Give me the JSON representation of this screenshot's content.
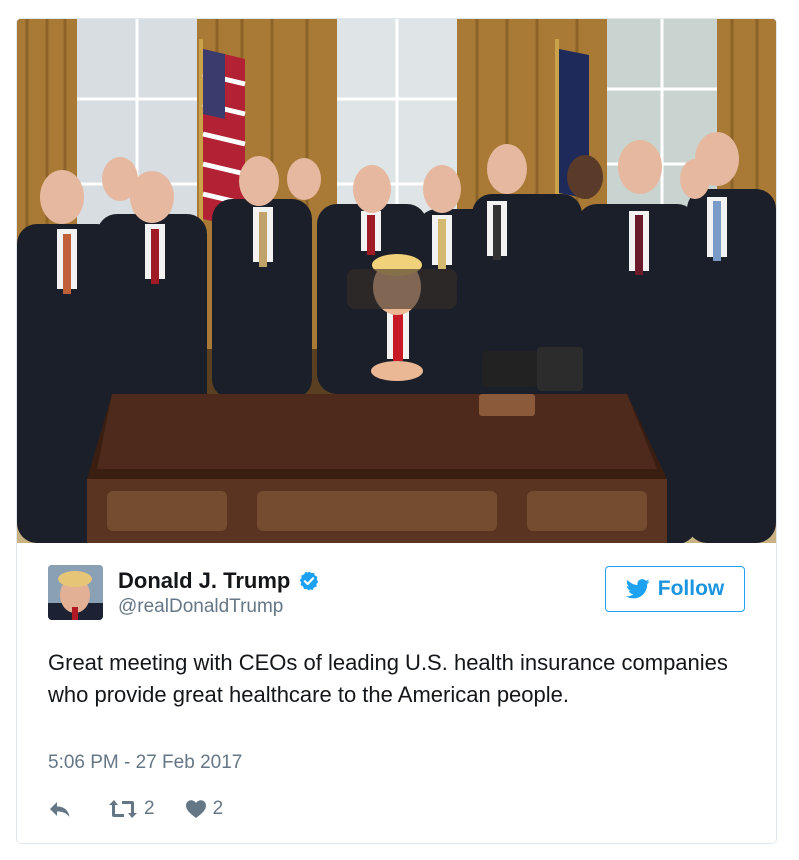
{
  "tweet": {
    "author": {
      "display_name": "Donald J. Trump",
      "handle": "@realDonaldTrump",
      "verified": true
    },
    "follow_label": "Follow",
    "text": "Great meeting with CEOs of leading U.S. health insurance companies who provide great healthcare to the American people.",
    "timestamp": "5:06 PM - 27 Feb 2017",
    "actions": {
      "reply_icon": "reply-icon",
      "retweet_icon": "retweet-icon",
      "retweet_count": "2",
      "like_icon": "heart-icon",
      "like_count": "2"
    },
    "colors": {
      "accent": "#1da1f2",
      "text": "#14171a",
      "muted": "#657786",
      "border": "#e1e8ed"
    }
  }
}
